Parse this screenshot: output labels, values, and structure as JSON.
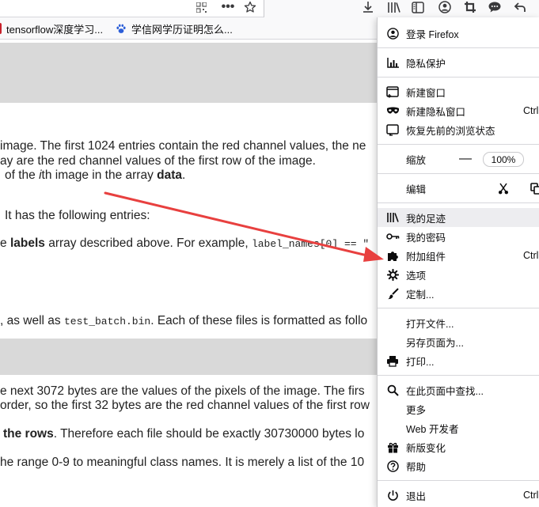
{
  "toolbar": {
    "icons": [
      "qr-code-icon",
      "more-icon",
      "star-icon",
      "download-icon",
      "library-icon",
      "sidebar-icon",
      "account-icon",
      "crop-icon",
      "chat-icon",
      "back-icon"
    ]
  },
  "bookmarks": [
    {
      "label": "tensorflow深度学习..."
    },
    {
      "label": "学信网学历证明怎么..."
    }
  ],
  "page": {
    "p1": "image. The first 1024 entries contain the red channel values, the ne",
    "p2": "ay are the red channel values of the first row of the image.",
    "p3_pre": "of the ",
    "p3_i": "i",
    "p3_mid": "th image in the array ",
    "p3_b": "data",
    "p3_end": ".",
    "p4": "It has the following entries:",
    "p5_pre": "e ",
    "p5_b": "labels",
    "p5_mid": " array described above. For example, ",
    "p5_code": "label_names[0] == \"",
    "p6_pre": ", as well as ",
    "p6_code": "test_batch.bin",
    "p6_end": ". Each of these files is formatted as follo",
    "p7": "e next 3072 bytes are the values of the pixels of the image. The firs",
    "p8": "order, so the first 32 bytes are the red channel values of the first row",
    "p9_b": "the rows",
    "p9_end": ". Therefore each file should be exactly 30730000 bytes lo",
    "p10": "he range 0-9 to meaningful class names. It is merely a list of the 10"
  },
  "menu": {
    "sign_in": "登录 Firefox",
    "privacy": "隐私保护",
    "new_window": "新建窗口",
    "new_private": "新建隐私窗口",
    "new_private_shortcut": "Ctrl",
    "restore_session": "恢复先前的浏览状态",
    "zoom_label": "缩放",
    "zoom_minus": "—",
    "zoom_value": "100%",
    "edit_label": "编辑",
    "library": "我的足迹",
    "logins": "我的密码",
    "addons": "附加组件",
    "addons_shortcut": "Ctrl",
    "options": "选项",
    "customize": "定制...",
    "open_file": "打开文件...",
    "save_page": "另存页面为...",
    "print": "打印...",
    "find": "在此页面中查找...",
    "more": "更多",
    "web_developer": "Web 开发者",
    "whats_new": "新版变化",
    "help": "帮助",
    "quit": "退出",
    "quit_shortcut": "Ctrl-"
  },
  "colors": {
    "arrow": "#e8403f",
    "highlight": "#ededf0",
    "band": "#d9d9d9"
  }
}
